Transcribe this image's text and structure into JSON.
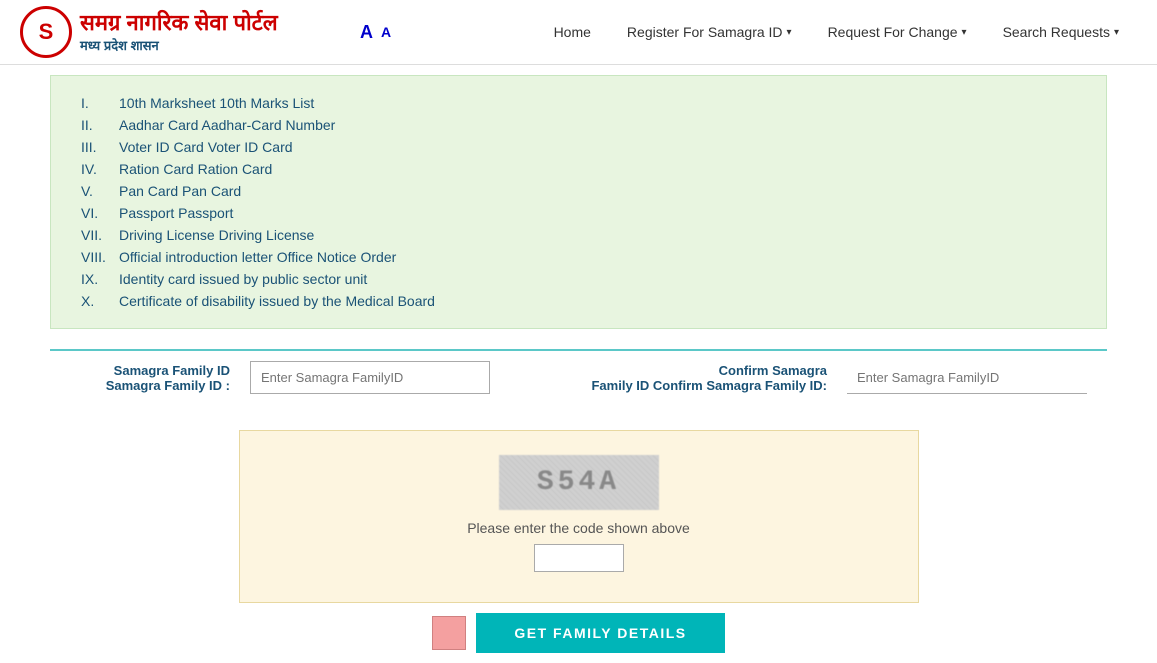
{
  "header": {
    "logo_letter": "S",
    "logo_title": "समग्र नागरिक सेवा पोर्टल",
    "logo_subtitle": "मध्य प्रदेश शासन",
    "font_large": "A",
    "font_small": "A",
    "nav": {
      "home": "Home",
      "register": "Register For Samagra ID",
      "request_change": "Request For Change",
      "search_requests": "Search Requests"
    }
  },
  "list": {
    "items": [
      {
        "roman": "I.",
        "text": "10th Marksheet 10th Marks List"
      },
      {
        "roman": "II.",
        "text": "Aadhar Card Aadhar-Card Number"
      },
      {
        "roman": "III.",
        "text": "Voter ID Card Voter ID Card"
      },
      {
        "roman": "IV.",
        "text": "Ration Card Ration Card"
      },
      {
        "roman": "V.",
        "text": "Pan Card Pan Card"
      },
      {
        "roman": "VI.",
        "text": "Passport Passport"
      },
      {
        "roman": "VII.",
        "text": "Driving License Driving License"
      },
      {
        "roman": "VIII.",
        "text": "Official introduction letter Office Notice Order"
      },
      {
        "roman": "IX.",
        "text": "Identity card issued by public sector unit"
      },
      {
        "roman": "X.",
        "text": "Certificate of disability issued by the Medical Board"
      }
    ]
  },
  "form": {
    "samagra_label_1": "Samagra Family ID",
    "samagra_label_2": "Samagra Family ID :",
    "samagra_placeholder": "Enter Samagra FamilyID",
    "confirm_label_1": "Confirm Samagra",
    "confirm_label_2": "Family ID Confirm Samagra Family ID:",
    "confirm_placeholder": "Enter Samagra FamilyID"
  },
  "captcha": {
    "code": "S54A",
    "prompt": "Please enter the code shown above",
    "input_placeholder": ""
  },
  "buttons": {
    "get_details": "GET FAMILY DETAILS"
  }
}
